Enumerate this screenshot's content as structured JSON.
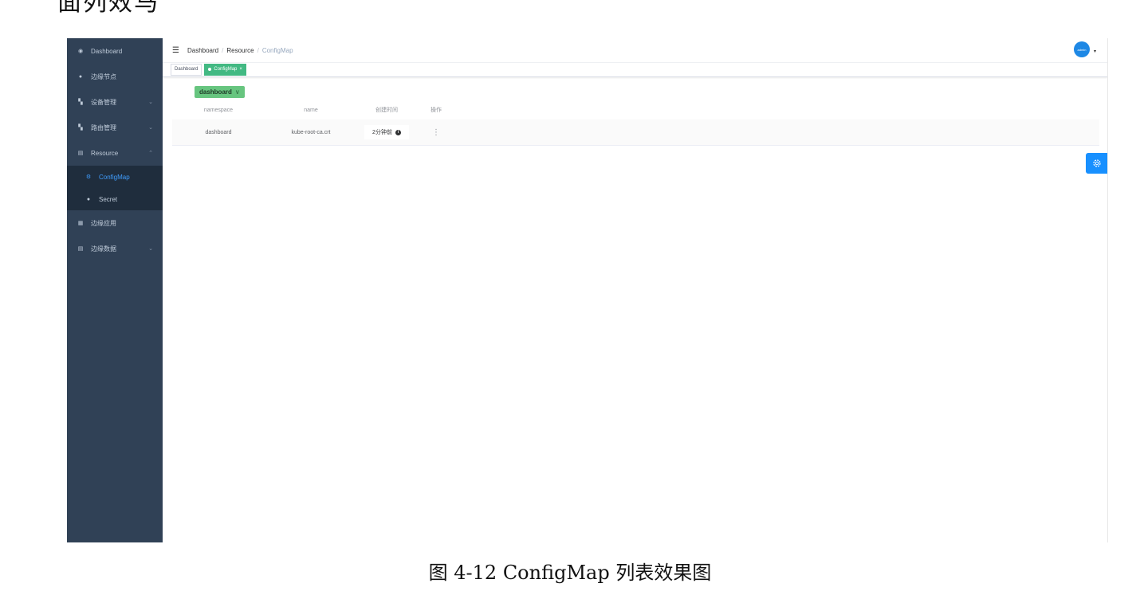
{
  "doc": {
    "top_fragment": "面列效马",
    "caption": "图 4-12  ConfigMap 列表效果图"
  },
  "sidebar": {
    "items": [
      {
        "label": "Dashboard",
        "icon": "dashboard-icon"
      },
      {
        "label": "边缘节点",
        "icon": "dot-icon"
      },
      {
        "label": "设备管理",
        "icon": "device-icon",
        "chevron": "⌄"
      },
      {
        "label": "路由管理",
        "icon": "route-icon",
        "chevron": "⌄"
      },
      {
        "label": "Resource",
        "icon": "resource-icon",
        "chevron": "⌃"
      },
      {
        "label": "边缘应用",
        "icon": "apps-icon"
      },
      {
        "label": "边缘数据",
        "icon": "data-icon",
        "chevron": "⌄"
      }
    ],
    "submenu": [
      {
        "label": "ConfigMap",
        "icon": "configmap-icon",
        "active": true
      },
      {
        "label": "Secret",
        "icon": "secret-icon",
        "active": false
      }
    ]
  },
  "navbar": {
    "breadcrumb": [
      "Dashboard",
      "Resource",
      "ConfigMap"
    ],
    "separator": "/",
    "avatar_text": "admin",
    "caret": "▾"
  },
  "tags": [
    {
      "label": "Dashboard",
      "active": false
    },
    {
      "label": "ConfigMap",
      "active": true,
      "close": "×"
    }
  ],
  "namespace_select": {
    "value": "dashboard",
    "chevron": "∨"
  },
  "table": {
    "columns": [
      "namespace",
      "name",
      "创建时间",
      "操作"
    ],
    "rows": [
      {
        "namespace": "dashboard",
        "name": "kube-root-ca.crt",
        "created": "2分钟前",
        "op": "⋮"
      }
    ]
  },
  "colors": {
    "sidebar_bg": "#304156",
    "active_menu": "#409eff",
    "tag_active": "#42b983",
    "select_bg": "#67c57f",
    "fab": "#1890ff"
  }
}
